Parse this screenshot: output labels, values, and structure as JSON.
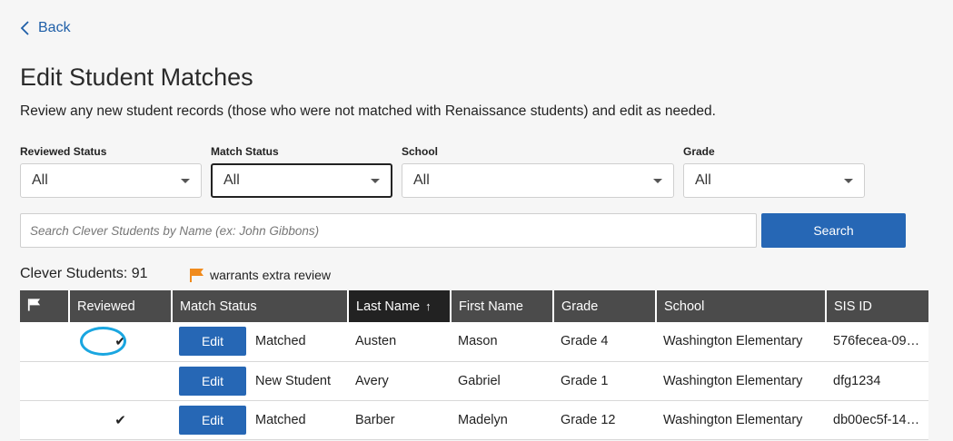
{
  "nav": {
    "back_label": "Back"
  },
  "page": {
    "title": "Edit Student Matches",
    "subtitle": "Review any new student records (those who were not matched with Renaissance students) and edit as needed."
  },
  "filters": [
    {
      "label": "Reviewed Status",
      "value": "All"
    },
    {
      "label": "Match Status",
      "value": "All"
    },
    {
      "label": "School",
      "value": "All"
    },
    {
      "label": "Grade",
      "value": "All"
    }
  ],
  "search": {
    "placeholder": "Search Clever Students by Name (ex: John Gibbons)",
    "button_label": "Search"
  },
  "summary": {
    "count_text": "Clever Students: 91",
    "legend_text": "warrants extra review"
  },
  "colors": {
    "accent": "#2667b5",
    "flag": "#f08a1c",
    "highlight": "#1aa6e0",
    "header": "#4b4b4b"
  },
  "table": {
    "columns": [
      "Reviewed",
      "Match Status",
      "Last Name",
      "First Name",
      "Grade",
      "School",
      "SIS ID"
    ],
    "sort_arrow": "↑",
    "edit_label": "Edit",
    "check_mark": "✔",
    "rows": [
      {
        "reviewed": true,
        "match_status": "Matched",
        "last_name": "Austen",
        "first_name": "Mason",
        "grade": "Grade 4",
        "school": "Washington Elementary",
        "sis_id": "576fecea-09e..."
      },
      {
        "reviewed": false,
        "match_status": "New Student",
        "last_name": "Avery",
        "first_name": "Gabriel",
        "grade": "Grade 1",
        "school": "Washington Elementary",
        "sis_id": "dfg1234"
      },
      {
        "reviewed": true,
        "match_status": "Matched",
        "last_name": "Barber",
        "first_name": "Madelyn",
        "grade": "Grade 12",
        "school": "Washington Elementary",
        "sis_id": "db00ec5f-149..."
      }
    ]
  }
}
